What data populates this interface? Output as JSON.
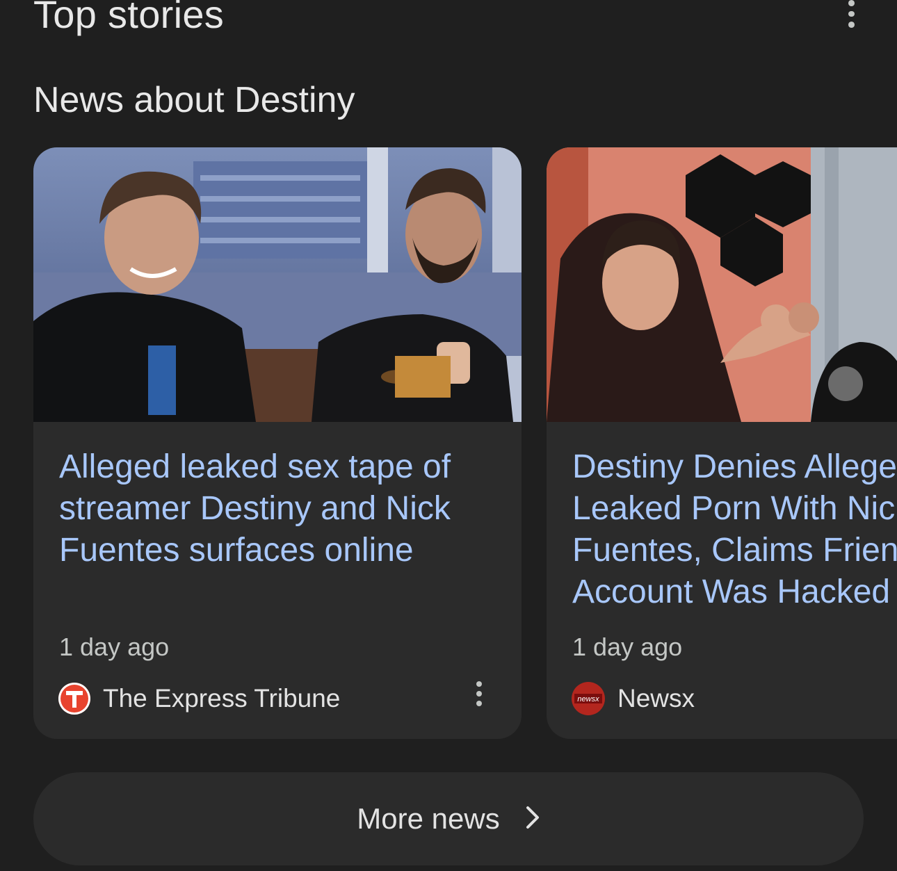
{
  "header": {
    "title": "Top stories",
    "menu_icon": "more-vert-icon"
  },
  "section": {
    "title": "News about Destiny"
  },
  "cards": [
    {
      "headline": "Alleged leaked sex tape of\nstreamer Destiny and Nick\nFuentes surfaces online",
      "time": "1 day ago",
      "source": "The Express Tribune",
      "source_logo": "express-tribune-logo",
      "menu_icon": "more-vert-icon"
    },
    {
      "headline_lines": [
        "Destiny Denies Allege",
        "Leaked Porn With Nic",
        "Fuentes, Claims Frien",
        "Account Was Hacked"
      ],
      "time": "1 day ago",
      "source": "Newsx",
      "source_logo": "newsx-logo",
      "logo_text": "newsx"
    }
  ],
  "more_news": {
    "label": "More news",
    "icon": "chevron-right-icon"
  },
  "colors": {
    "background": "#1f1f1f",
    "card": "#2b2b2b",
    "headline_link": "#a8c7fa",
    "secondary_text": "#c4c7c5"
  }
}
